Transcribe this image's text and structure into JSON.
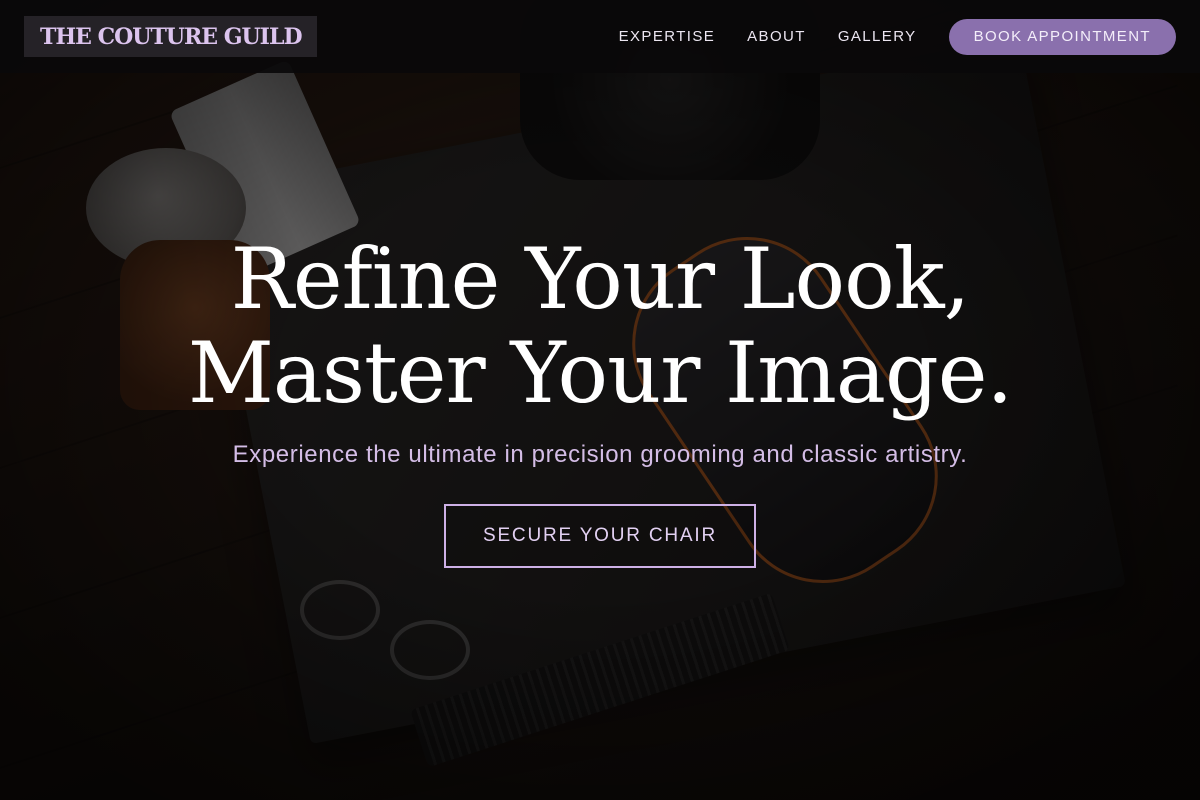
{
  "header": {
    "brand": "THE COUTURE GUILD",
    "nav": [
      "EXPERTISE",
      "ABOUT",
      "GALLERY"
    ],
    "book_label": "BOOK APPOINTMENT"
  },
  "hero": {
    "headline_line1": "Refine Your Look,",
    "headline_line2": "Master Your Image.",
    "subtext": "Experience the ultimate in precision grooming and classic artistry.",
    "cta_label": "SECURE YOUR CHAIR",
    "background_image": "barber-tools-flatlay"
  },
  "colors": {
    "accent": "#8a70ad",
    "brand_text": "#dcc4ee",
    "subtext": "#d4bde6",
    "cta_border": "#cdb0e6",
    "header_bg": "#0a090a"
  }
}
